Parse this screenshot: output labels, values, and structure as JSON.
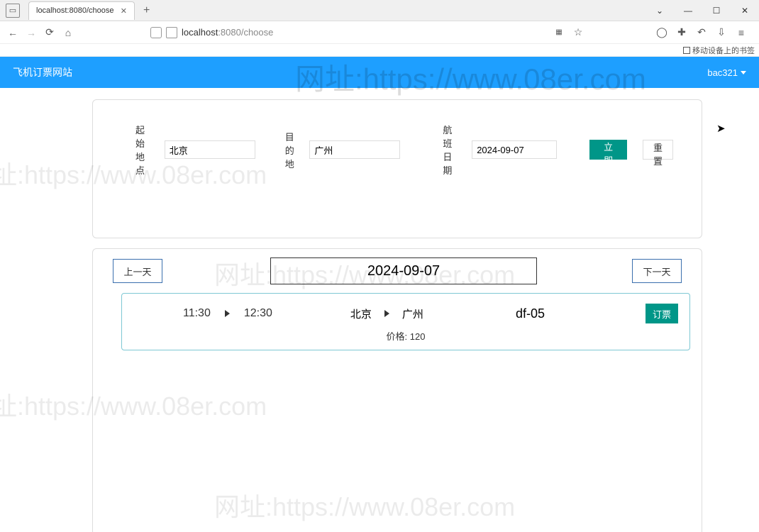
{
  "browser": {
    "tab_title": "localhost:8080/choose",
    "url_full": "localhost:8080/choose",
    "url_host": "localhost",
    "url_path": ":8080/choose",
    "bookmark_mobile": "移动设备上的书签"
  },
  "header": {
    "site_title": "飞机订票网站",
    "user": "bac321",
    "watermark": "网址:https://www.08er.com"
  },
  "search": {
    "origin_label": "起始地点",
    "origin_value": "北京",
    "dest_label": "目的地",
    "dest_value": "广州",
    "date_label": "航班日期",
    "date_value": "2024-09-07",
    "submit_label": "立即提交",
    "reset_label": "重置"
  },
  "datebar": {
    "prev_label": "上一天",
    "next_label": "下一天",
    "current_date": "2024-09-07"
  },
  "flights": [
    {
      "dep_time": "11:30",
      "arr_time": "12:30",
      "origin": "北京",
      "dest": "广州",
      "flight_no": "df-05",
      "price_label": "价格:",
      "price_value": "120",
      "book_label": "订票"
    }
  ],
  "watermark_text": "网址:https://www.08er.com"
}
